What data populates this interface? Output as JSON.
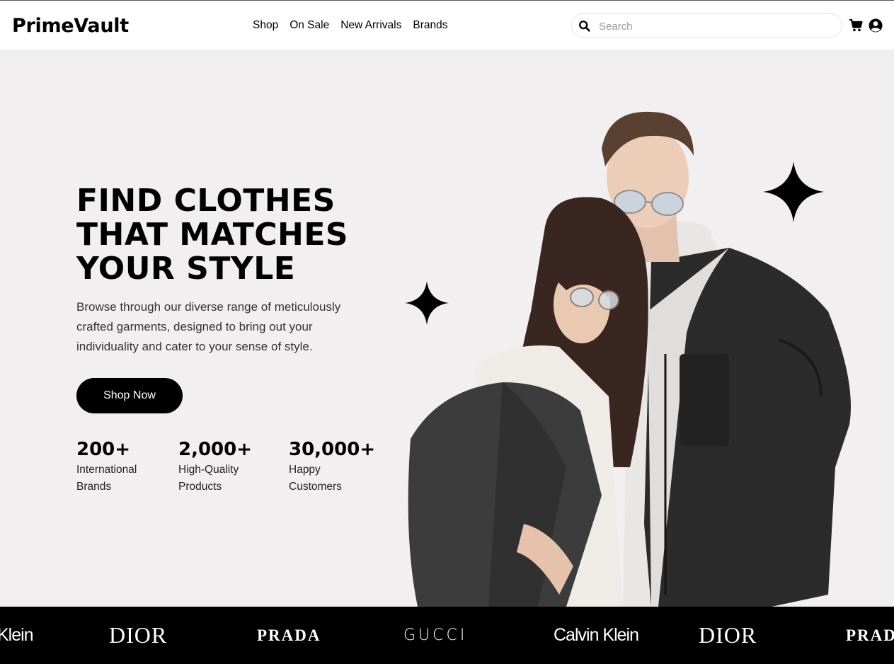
{
  "header": {
    "logo": "PrimeVault",
    "nav": [
      "Shop",
      "On Sale",
      "New Arrivals",
      "Brands"
    ],
    "search_placeholder": "Search",
    "icons": [
      "search-icon",
      "cart-icon",
      "user-account-icon"
    ]
  },
  "hero": {
    "title_lines": [
      "FIND CLOTHES",
      "THAT MATCHES",
      "YOUR STYLE"
    ],
    "description": "Browse through our diverse range of meticulously crafted garments, designed to bring out your individuality and cater to your sense of style.",
    "cta_label": "Shop Now",
    "stats": [
      {
        "value": "200+",
        "label": "International Brands"
      },
      {
        "value": "2,000+",
        "label": "High-Quality Products"
      },
      {
        "value": "30,000+",
        "label": "Happy Customers"
      }
    ]
  },
  "brands": [
    "Klein",
    "DIOR",
    "PRADA",
    "GUCCI",
    "Calvin Klein",
    "DIOR",
    "PRAD"
  ],
  "colors": {
    "background": "#f1eff0",
    "header_bg": "#ffffff",
    "primary": "#000000",
    "brand_strip": "#000000"
  }
}
